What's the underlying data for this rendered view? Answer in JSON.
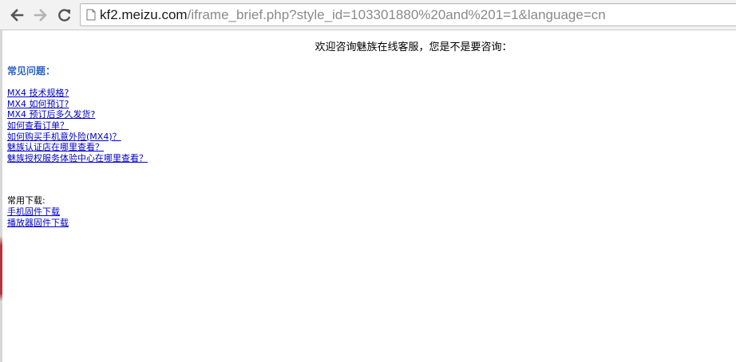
{
  "browser": {
    "url_host": "kf2.meizu.com",
    "url_rest": "/iframe_brief.php?style_id=103301880%20and%201=1&language=cn"
  },
  "page": {
    "welcome": "欢迎咨询魅族在线客服，您是不是要咨询：",
    "faq_heading": "常见问题：",
    "faq_items": [
      "MX4 技术规格?",
      "MX4 如何预订?",
      "MX4 预订后多久发货?",
      "如何查看订单？",
      "如何购买手机意外险(MX4)？",
      "魅族认证店在哪里查看？",
      "魅族授权服务体验中心在哪里查看？"
    ],
    "downloads_label": "常用下载:",
    "download_items": [
      "手机固件下载",
      "播放器固件下载"
    ]
  }
}
